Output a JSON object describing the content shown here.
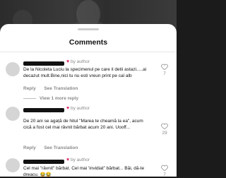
{
  "sheet": {
    "title": "Comments"
  },
  "comments": [
    {
      "by_author": "by author",
      "text": "De la Nicoleta Luciu la specimenul pe care il detii astazi.....ai decazut mult.Bine,nici tu nu esti vreun print pe cal alb",
      "reply_label": "Reply",
      "translate_label": "See Translation",
      "likes": "7",
      "view_replies": "View 1 more reply"
    },
    {
      "by_author": "by author",
      "text": "De 20 ani se agață de hitul \"Marea te cheamă la ea\", acum cică a fost cel mai râvnit bărbat acum 20 ani. Uooff...",
      "reply_label": "Reply",
      "translate_label": "See Translation",
      "likes": "29"
    },
    {
      "by_author": "by author",
      "text": "Cel mai \"râvnit\" bărbat. Cel mai 'invidiat\" bărbat... Băi, dă-te dreacu. 😂😂",
      "likes": "7"
    }
  ]
}
